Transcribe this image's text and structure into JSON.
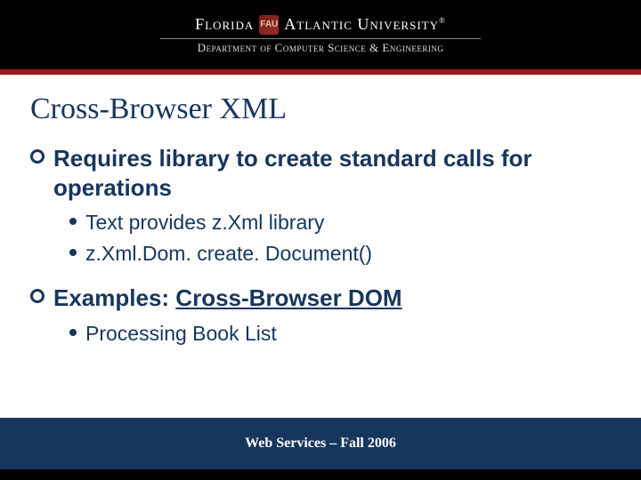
{
  "header": {
    "university_left": "Florida",
    "university_right": "Atlantic University",
    "reg": "®",
    "department": "Department of Computer Science & Engineering"
  },
  "title": "Cross-Browser XML",
  "bullets": [
    {
      "text": "Requires library to create standard calls for operations",
      "sub": [
        {
          "text": "Text provides z.Xml library"
        },
        {
          "text": "z.Xml.Dom. create. Document()"
        }
      ]
    },
    {
      "text_prefix": "Examples: ",
      "text_link": "Cross-Browser DOM",
      "sub": [
        {
          "text": "Processing Book List"
        }
      ]
    }
  ],
  "footer": "Web Services – Fall 2006"
}
